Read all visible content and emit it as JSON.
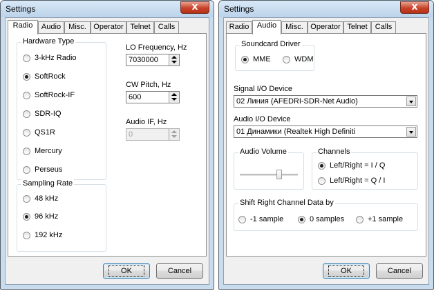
{
  "left_dialog": {
    "title": "Settings",
    "close_glyph": "x",
    "tabs": [
      {
        "label": "Radio",
        "active": true
      },
      {
        "label": "Audio"
      },
      {
        "label": "Misc."
      },
      {
        "label": "Operator"
      },
      {
        "label": "Telnet"
      },
      {
        "label": "Calls"
      }
    ],
    "hardware_type": {
      "legend": "Hardware Type",
      "options": [
        "3-kHz Radio",
        "SoftRock",
        "SoftRock-IF",
        "SDR-IQ",
        "QS1R",
        "Mercury",
        "Perseus"
      ],
      "selected": "SoftRock"
    },
    "lo_frequency": {
      "label": "LO Frequency, Hz",
      "value": "7030000"
    },
    "cw_pitch": {
      "label": "CW Pitch, Hz",
      "value": "600"
    },
    "audio_if": {
      "label": "Audio IF, Hz",
      "value": "0",
      "disabled": true
    },
    "sampling_rate": {
      "legend": "Sampling Rate",
      "options": [
        "48 kHz",
        "96 kHz",
        "192 kHz"
      ],
      "selected": "96 kHz"
    },
    "ok_label": "OK",
    "cancel_label": "Cancel"
  },
  "right_dialog": {
    "title": "Settings",
    "close_glyph": "x",
    "tabs": [
      {
        "label": "Radio"
      },
      {
        "label": "Audio",
        "active": true
      },
      {
        "label": "Misc."
      },
      {
        "label": "Operator"
      },
      {
        "label": "Telnet"
      },
      {
        "label": "Calls"
      }
    ],
    "soundcard_driver": {
      "legend": "Soundcard Driver",
      "options": [
        "MME",
        "WDM"
      ],
      "selected": "MME"
    },
    "signal_device": {
      "label": "Signal I/O Device",
      "value": "02  Линия (AFEDRI-SDR-Net Audio)"
    },
    "audio_device": {
      "label": "Audio I/O Device",
      "value": "01  Динамики (Realtek High Definiti"
    },
    "audio_volume": {
      "legend": "Audio Volume",
      "level": 0.7
    },
    "channels": {
      "legend": "Channels",
      "options": [
        "Left/Right = I / Q",
        "Left/Right = Q / I"
      ],
      "selected": "Left/Right = I / Q"
    },
    "shift": {
      "legend": "Shift Right Channel Data by",
      "options": [
        "-1 sample",
        "0 samples",
        "+1 sample"
      ],
      "selected": "0 samples"
    },
    "ok_label": "OK",
    "cancel_label": "Cancel"
  }
}
